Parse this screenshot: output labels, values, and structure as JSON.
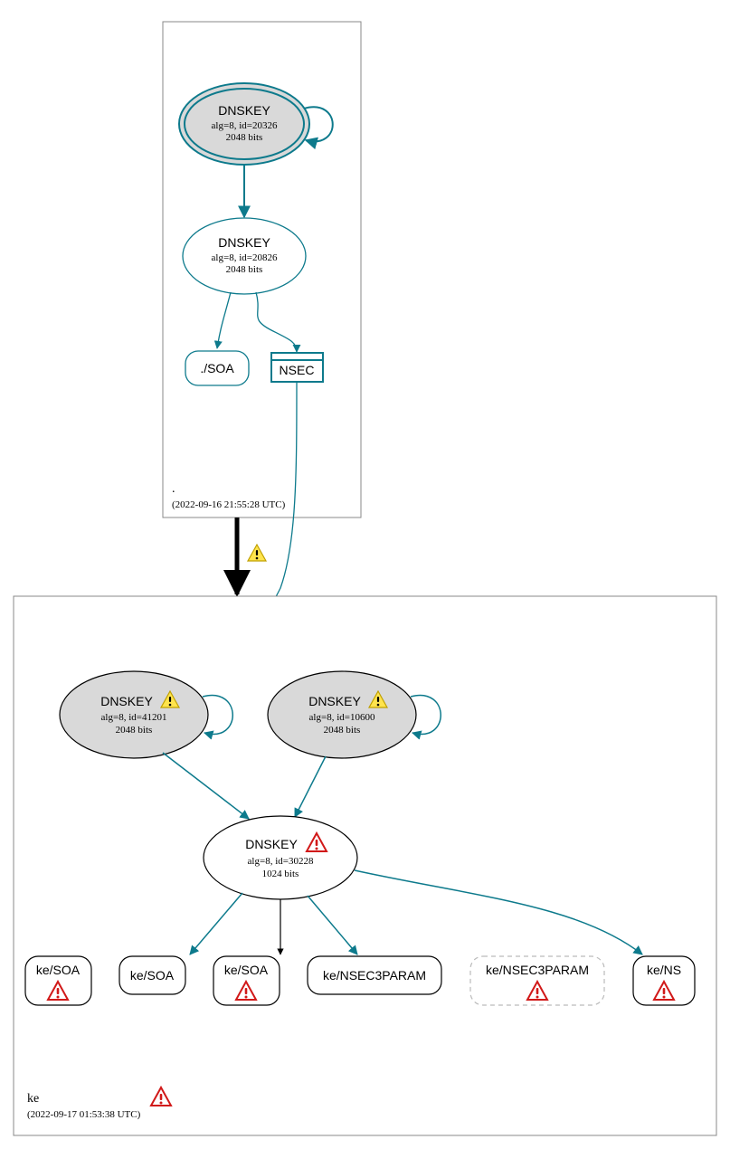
{
  "root_zone": {
    "label": ".",
    "timestamp": "(2022-09-16 21:55:28 UTC)",
    "ksk": {
      "title": "DNSKEY",
      "line1": "alg=8, id=20326",
      "line2": "2048 bits"
    },
    "zsk": {
      "title": "DNSKEY",
      "line1": "alg=8, id=20826",
      "line2": "2048 bits"
    },
    "soa": "./SOA",
    "nsec": "NSEC"
  },
  "ke_zone": {
    "label": "ke",
    "timestamp": "(2022-09-17 01:53:38 UTC)",
    "ksk1": {
      "title": "DNSKEY",
      "line1": "alg=8, id=41201",
      "line2": "2048 bits"
    },
    "ksk2": {
      "title": "DNSKEY",
      "line1": "alg=8, id=10600",
      "line2": "2048 bits"
    },
    "zsk": {
      "title": "DNSKEY",
      "line1": "alg=8, id=30228",
      "line2": "1024 bits"
    },
    "rr": {
      "soa1": "ke/SOA",
      "soa2": "ke/SOA",
      "soa3": "ke/SOA",
      "n3p1": "ke/NSEC3PARAM",
      "n3p2": "ke/NSEC3PARAM",
      "ns": "ke/NS"
    }
  }
}
